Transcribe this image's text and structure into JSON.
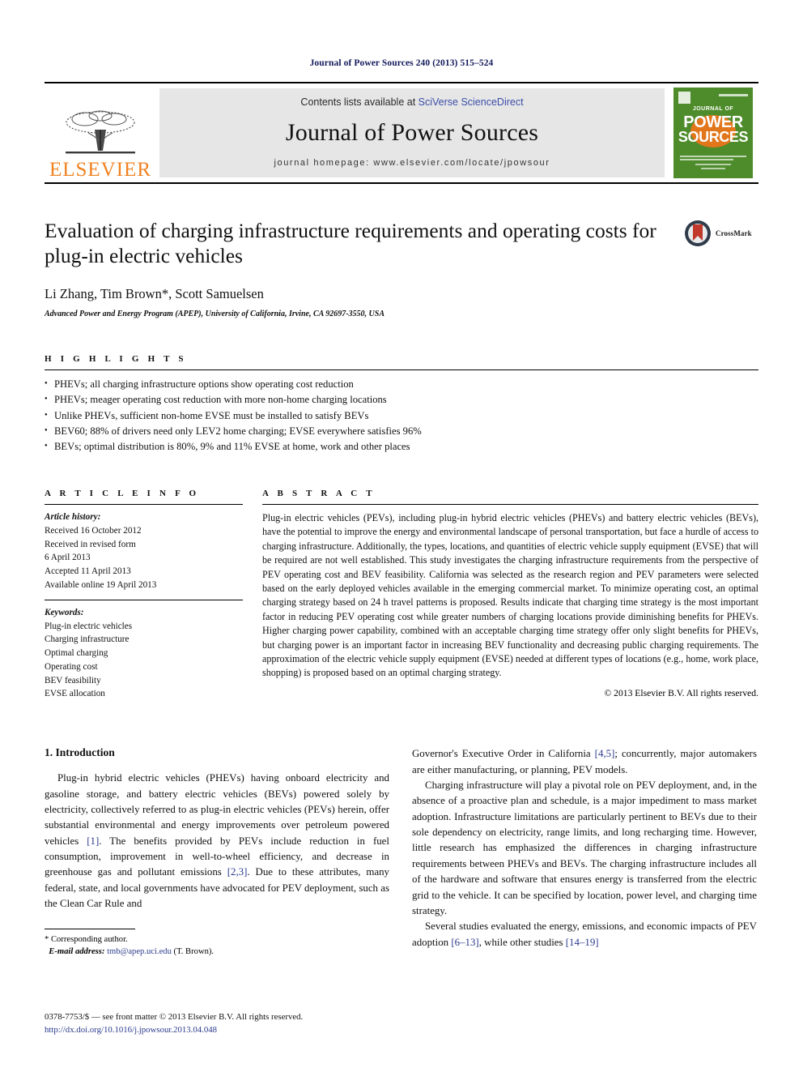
{
  "running_head": "Journal of Power Sources 240 (2013) 515–524",
  "masthead": {
    "contents_prefix": "Contents lists available at ",
    "sciencedirect": "SciVerse ScienceDirect",
    "journal_name": "Journal of Power Sources",
    "homepage": "journal homepage: www.elsevier.com/locate/jpowsour",
    "publisher": "ELSEVIER",
    "cover": {
      "line1": "JOURNAL OF",
      "line2": "POWER",
      "line3": "SOURCES"
    }
  },
  "article": {
    "title": "Evaluation of charging infrastructure requirements and operating costs for plug-in electric vehicles",
    "authors": "Li Zhang, Tim Brown*, Scott Samuelsen",
    "affiliation": "Advanced Power and Energy Program (APEP), University of California, Irvine, CA 92697-3550, USA",
    "crossmark_label": "CrossMark"
  },
  "highlights": {
    "heading": "H I G H L I G H T S",
    "items": [
      "PHEVs; all charging infrastructure options show operating cost reduction",
      "PHEVs; meager operating cost reduction with more non-home charging locations",
      "Unlike PHEVs, sufficient non-home EVSE must be installed to satisfy BEVs",
      "BEV60; 88% of drivers need only LEV2 home charging; EVSE everywhere satisfies 96%",
      "BEVs; optimal distribution is 80%, 9% and 11% EVSE at home, work and other places"
    ]
  },
  "article_info": {
    "heading": "A R T I C L E   I N F O",
    "history_label": "Article history:",
    "history": [
      "Received 16 October 2012",
      "Received in revised form",
      "6 April 2013",
      "Accepted 11 April 2013",
      "Available online 19 April 2013"
    ],
    "keywords_label": "Keywords:",
    "keywords": [
      "Plug-in electric vehicles",
      "Charging infrastructure",
      "Optimal charging",
      "Operating cost",
      "BEV feasibility",
      "EVSE allocation"
    ]
  },
  "abstract": {
    "heading": "A B S T R A C T",
    "text": "Plug-in electric vehicles (PEVs), including plug-in hybrid electric vehicles (PHEVs) and battery electric vehicles (BEVs), have the potential to improve the energy and environmental landscape of personal transportation, but face a hurdle of access to charging infrastructure. Additionally, the types, locations, and quantities of electric vehicle supply equipment (EVSE) that will be required are not well established. This study investigates the charging infrastructure requirements from the perspective of PEV operating cost and BEV feasibility. California was selected as the research region and PEV parameters were selected based on the early deployed vehicles available in the emerging commercial market. To minimize operating cost, an optimal charging strategy based on 24 h travel patterns is proposed. Results indicate that charging time strategy is the most important factor in reducing PEV operating cost while greater numbers of charging locations provide diminishing benefits for PHEVs. Higher charging power capability, combined with an acceptable charging time strategy offer only slight benefits for PHEVs, but charging power is an important factor in increasing BEV functionality and decreasing public charging requirements. The approximation of the electric vehicle supply equipment (EVSE) needed at different types of locations (e.g., home, work place, shopping) is proposed based on an optimal charging strategy.",
    "copyright": "© 2013 Elsevier B.V. All rights reserved."
  },
  "introduction": {
    "heading": "1. Introduction",
    "left_p1_a": "Plug-in hybrid electric vehicles (PHEVs) having onboard electricity and gasoline storage, and battery electric vehicles (BEVs) powered solely by electricity, collectively referred to as plug-in electric vehicles (PEVs) herein, offer substantial environmental and energy improvements over petroleum powered vehicles ",
    "left_cite1": "[1]",
    "left_p1_b": ". The benefits provided by PEVs include reduction in fuel consumption, improvement in well-to-wheel efficiency, and decrease in greenhouse gas and pollutant emissions ",
    "left_cite2": "[2,3]",
    "left_p1_c": ". Due to these attributes, many federal, state, and local governments have advocated for PEV deployment, such as the Clean Car Rule and",
    "right_p1_a": "Governor's Executive Order in California ",
    "right_cite1": "[4,5]",
    "right_p1_b": "; concurrently, major automakers are either manufacturing, or planning, PEV models.",
    "right_p2": "Charging infrastructure will play a pivotal role on PEV deployment, and, in the absence of a proactive plan and schedule, is a major impediment to mass market adoption. Infrastructure limitations are particularly pertinent to BEVs due to their sole dependency on electricity, range limits, and long recharging time. However, little research has emphasized the differences in charging infrastructure requirements between PHEVs and BEVs. The charging infrastructure includes all of the hardware and software that ensures energy is transferred from the electric grid to the vehicle. It can be specified by location, power level, and charging time strategy.",
    "right_p3_a": "Several studies evaluated the energy, emissions, and economic impacts of PEV adoption ",
    "right_cite2": "[6–13]",
    "right_p3_b": ", while other studies ",
    "right_cite3": "[14–19]"
  },
  "footnote": {
    "corresponding": "* Corresponding author.",
    "email_label": "E-mail address:",
    "email": "tmb@apep.uci.edu",
    "email_suffix": " (T. Brown)."
  },
  "bottom_matter": {
    "issn_line": "0378-7753/$ — see front matter © 2013 Elsevier B.V. All rights reserved.",
    "doi": "http://dx.doi.org/10.1016/j.jpowsour.2013.04.048"
  }
}
